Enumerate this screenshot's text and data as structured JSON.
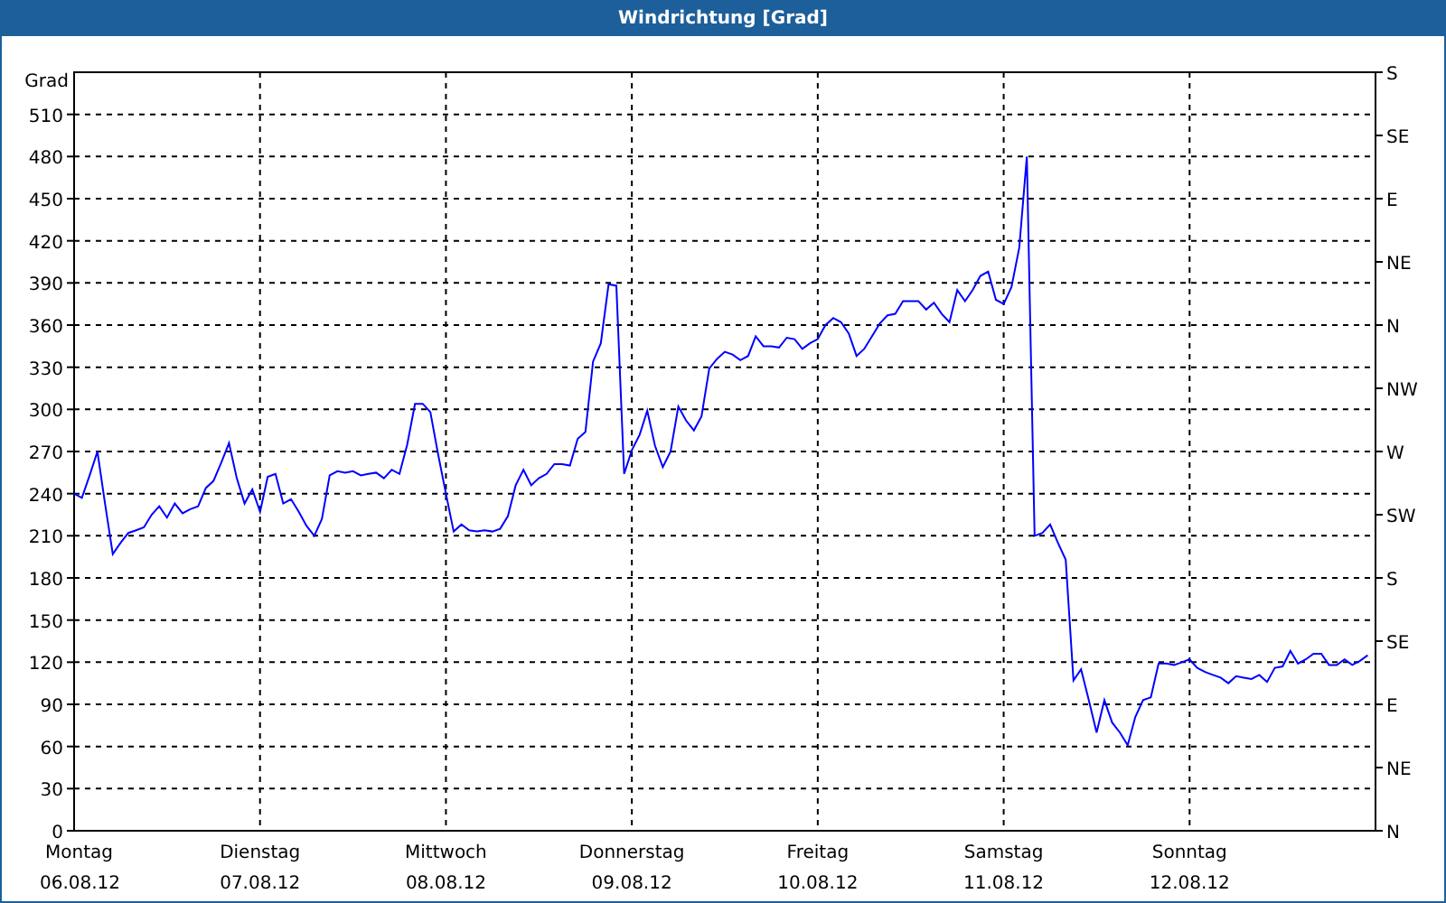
{
  "window": {
    "title": "Windrichtung [Grad]"
  },
  "chart": {
    "dates": [
      "06.08.12",
      "07.08.12",
      "08.08.12",
      "09.08.12",
      "10.08.12",
      "11.08.12",
      "12.08.12"
    ],
    "compass_labels": [
      "S",
      "SE",
      "E",
      "NE",
      "N",
      "NW",
      "W",
      "SW",
      "S",
      "SE",
      "E",
      "NE",
      "N"
    ],
    "chart_data": {
      "type": "line",
      "ylabel": "Grad",
      "ylim": [
        0,
        540
      ],
      "grid": true,
      "yticks": [
        0,
        30,
        60,
        90,
        120,
        150,
        180,
        210,
        240,
        270,
        300,
        330,
        360,
        390,
        420,
        450,
        480,
        510
      ],
      "categories": [
        "Montag",
        null,
        null,
        null,
        null,
        null,
        null,
        null,
        null,
        null,
        null,
        null,
        null,
        null,
        null,
        null,
        null,
        null,
        null,
        null,
        null,
        null,
        null,
        null,
        "Dienstag",
        null,
        null,
        null,
        null,
        null,
        null,
        null,
        null,
        null,
        null,
        null,
        null,
        null,
        null,
        null,
        null,
        null,
        null,
        null,
        null,
        null,
        null,
        null,
        "Mittwoch",
        null,
        null,
        null,
        null,
        null,
        null,
        null,
        null,
        null,
        null,
        null,
        null,
        null,
        null,
        null,
        null,
        null,
        null,
        null,
        null,
        null,
        null,
        null,
        "Donnerstag",
        null,
        null,
        null,
        null,
        null,
        null,
        null,
        null,
        null,
        null,
        null,
        null,
        null,
        null,
        null,
        null,
        null,
        null,
        null,
        null,
        null,
        null,
        null,
        "Freitag",
        null,
        null,
        null,
        null,
        null,
        null,
        null,
        null,
        null,
        null,
        null,
        null,
        null,
        null,
        null,
        null,
        null,
        null,
        null,
        null,
        null,
        null,
        null,
        "Samstag",
        null,
        null,
        null,
        null,
        null,
        null,
        null,
        null,
        null,
        null,
        null,
        null,
        null,
        null,
        null,
        null,
        null,
        null,
        null,
        null,
        null,
        null,
        null,
        "Sonntag",
        null,
        null,
        null,
        null,
        null,
        null,
        null,
        null,
        null,
        null,
        null,
        null,
        null,
        null,
        null,
        null,
        null,
        null,
        null,
        null,
        null,
        null,
        null
      ],
      "series": [
        {
          "color": "#0000ff",
          "values": [
            240,
            237,
            253,
            270,
            233,
            197,
            205,
            212,
            214,
            216,
            225,
            231,
            223,
            233,
            226,
            229,
            231,
            244,
            249,
            262,
            276,
            251,
            233,
            243,
            227,
            252,
            254,
            233,
            236,
            227,
            217,
            210,
            222,
            253,
            256,
            255,
            256,
            253,
            254,
            255,
            251,
            257,
            254,
            275,
            304,
            304,
            298,
            268,
            240,
            213,
            218,
            214,
            213,
            214,
            213,
            215,
            224,
            246,
            257,
            246,
            251,
            254,
            261,
            261,
            260,
            279,
            284,
            334,
            347,
            389,
            388,
            254,
            271,
            282,
            299,
            274,
            259,
            270,
            302,
            292,
            285,
            295,
            329,
            336,
            341,
            339,
            335,
            338,
            352,
            345,
            345,
            344,
            351,
            350,
            343,
            347,
            350,
            360,
            365,
            362,
            354,
            338,
            343,
            352,
            361,
            367,
            368,
            377,
            377,
            377,
            371,
            376,
            368,
            362,
            385,
            377,
            385,
            395,
            398,
            378,
            375,
            387,
            415,
            480,
            210,
            212,
            218,
            205,
            193,
            107,
            115,
            93,
            70,
            93,
            77,
            70,
            61,
            81,
            93,
            95,
            119,
            119,
            118,
            120,
            122,
            116,
            113,
            111,
            109,
            105,
            110,
            109,
            108,
            111,
            106,
            116,
            117,
            128,
            119,
            122,
            126,
            126,
            118,
            118,
            122,
            118,
            121,
            125
          ]
        }
      ]
    }
  }
}
